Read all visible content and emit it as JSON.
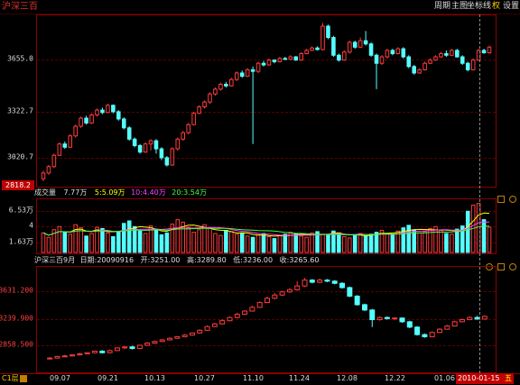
{
  "title": "沪深三百",
  "toolbar": {
    "zhouqi": "周期",
    "zhutu": "主图",
    "zuobiao": "坐标线",
    "quan": "权",
    "shezhi": "设置"
  },
  "main_axis": {
    "labels": [
      "3655.0",
      "3322.7",
      "3020.7"
    ],
    "current": "2818.2"
  },
  "volume": {
    "label": "成交量",
    "value": "7.77万",
    "ma5": "5:5.09万",
    "ma10": "10:4.40万",
    "ma20": "20:3.54万",
    "axis": [
      "6.53万",
      "4",
      "1.63万"
    ],
    "colors": {
      "ma5": "#ffff00",
      "ma10": "#ff40ff",
      "ma20": "#40ff40"
    }
  },
  "sub": {
    "name": "沪深三百9月",
    "date_label": "日期:",
    "date": "20090916",
    "open_label": "开:",
    "open": "3251.00",
    "high_label": "高:",
    "high": "3289.80",
    "low_label": "低:",
    "low": "3236.00",
    "close_label": "收:",
    "close": "3265.60",
    "axis": [
      "3631.200",
      "3239.900",
      "2858.500"
    ]
  },
  "xaxis": [
    "09.07",
    "09.21",
    "10.13",
    "10.27",
    "11.10",
    "11.24",
    "12.08",
    "12.22",
    "01.06"
  ],
  "bottom": {
    "code": "C1层",
    "date": "2010-01-15",
    "weekday": "五"
  },
  "colors": {
    "up": "#ff3b3b",
    "down": "#54ffff",
    "grid": "#5a0000",
    "frame": "#8b0000"
  },
  "chart_data": {
    "type": "candlestick",
    "main": {
      "ylim": [
        2818,
        3835
      ],
      "candles": [
        [
          2845,
          2880,
          2830,
          2895
        ],
        [
          2880,
          2920,
          2870,
          2930
        ],
        [
          2920,
          2990,
          2910,
          3000
        ],
        [
          2990,
          3060,
          2985,
          3070
        ],
        [
          3060,
          3040,
          3030,
          3075
        ],
        [
          3040,
          3110,
          3035,
          3120
        ],
        [
          3110,
          3170,
          3100,
          3180
        ],
        [
          3170,
          3220,
          3160,
          3230
        ],
        [
          3220,
          3190,
          3180,
          3235
        ],
        [
          3190,
          3240,
          3185,
          3250
        ],
        [
          3240,
          3270,
          3230,
          3280
        ],
        [
          3270,
          3255,
          3245,
          3285
        ],
        [
          3255,
          3300,
          3250,
          3310
        ],
        [
          3300,
          3260,
          3250,
          3305
        ],
        [
          3260,
          3215,
          3205,
          3270
        ],
        [
          3215,
          3160,
          3150,
          3225
        ],
        [
          3160,
          3090,
          3080,
          3170
        ],
        [
          3090,
          3050,
          3040,
          3100
        ],
        [
          3050,
          3010,
          3000,
          3060
        ],
        [
          3010,
          3060,
          3005,
          3070
        ],
        [
          3060,
          3080,
          3020,
          3090
        ],
        [
          3080,
          3030,
          3000,
          3090
        ],
        [
          3030,
          2975,
          2960,
          3040
        ],
        [
          2975,
          2930,
          2920,
          2985
        ],
        [
          2930,
          3030,
          2925,
          3040
        ],
        [
          3030,
          3090,
          3020,
          3100
        ],
        [
          3090,
          3130,
          3080,
          3140
        ],
        [
          3130,
          3180,
          3120,
          3190
        ],
        [
          3180,
          3250,
          3175,
          3260
        ],
        [
          3250,
          3290,
          3245,
          3300
        ],
        [
          3290,
          3320,
          3280,
          3330
        ],
        [
          3320,
          3370,
          3310,
          3380
        ],
        [
          3370,
          3400,
          3360,
          3410
        ],
        [
          3400,
          3430,
          3390,
          3440
        ],
        [
          3430,
          3420,
          3410,
          3445
        ],
        [
          3420,
          3460,
          3415,
          3470
        ],
        [
          3460,
          3500,
          3450,
          3510
        ],
        [
          3500,
          3480,
          3470,
          3515
        ],
        [
          3480,
          3520,
          3475,
          3530
        ],
        [
          3520,
          3510,
          3060,
          3540
        ],
        [
          3510,
          3560,
          3500,
          3570
        ],
        [
          3560,
          3550,
          3540,
          3575
        ],
        [
          3550,
          3580,
          3545,
          3590
        ],
        [
          3580,
          3570,
          3560,
          3585
        ],
        [
          3570,
          3590,
          3565,
          3600
        ],
        [
          3590,
          3585,
          3580,
          3600
        ],
        [
          3585,
          3600,
          3580,
          3610
        ],
        [
          3600,
          3580,
          3575,
          3605
        ],
        [
          3580,
          3620,
          3575,
          3630
        ],
        [
          3620,
          3640,
          3615,
          3650
        ],
        [
          3640,
          3655,
          3635,
          3665
        ],
        [
          3655,
          3645,
          3640,
          3665
        ],
        [
          3645,
          3790,
          3640,
          3810
        ],
        [
          3790,
          3720,
          3710,
          3800
        ],
        [
          3720,
          3610,
          3600,
          3730
        ],
        [
          3610,
          3580,
          3570,
          3620
        ],
        [
          3580,
          3630,
          3575,
          3640
        ],
        [
          3630,
          3690,
          3620,
          3700
        ],
        [
          3690,
          3660,
          3650,
          3700
        ],
        [
          3660,
          3700,
          3655,
          3720
        ],
        [
          3700,
          3680,
          3670,
          3760
        ],
        [
          3680,
          3610,
          3600,
          3690
        ],
        [
          3610,
          3560,
          3400,
          3620
        ],
        [
          3560,
          3600,
          3550,
          3610
        ],
        [
          3600,
          3640,
          3590,
          3650
        ],
        [
          3640,
          3620,
          3610,
          3650
        ],
        [
          3620,
          3650,
          3615,
          3660
        ],
        [
          3650,
          3600,
          3590,
          3660
        ],
        [
          3600,
          3540,
          3530,
          3610
        ],
        [
          3540,
          3500,
          3490,
          3550
        ],
        [
          3500,
          3520,
          3495,
          3530
        ],
        [
          3520,
          3560,
          3515,
          3570
        ],
        [
          3560,
          3580,
          3555,
          3590
        ],
        [
          3580,
          3600,
          3575,
          3610
        ],
        [
          3600,
          3620,
          3595,
          3630
        ],
        [
          3620,
          3610,
          3600,
          3640
        ],
        [
          3610,
          3640,
          3605,
          3650
        ],
        [
          3640,
          3600,
          3595,
          3650
        ],
        [
          3600,
          3560,
          3550,
          3610
        ],
        [
          3560,
          3520,
          3510,
          3570
        ],
        [
          3520,
          3580,
          3515,
          3590
        ],
        [
          3580,
          3640,
          3575,
          3650
        ],
        [
          3640,
          3625,
          3620,
          3650
        ],
        [
          3625,
          3660,
          3620,
          3670
        ]
      ]
    },
    "volume": {
      "values": [
        3.1,
        2.4,
        3.6,
        4.1,
        3.2,
        2.9,
        4.4,
        3.9,
        2.6,
        3.0,
        4.0,
        3.8,
        3.1,
        2.5,
        3.3,
        4.6,
        5.0,
        4.1,
        3.4,
        3.0,
        4.2,
        3.7,
        2.8,
        3.1,
        4.5,
        5.2,
        4.8,
        4.0,
        3.2,
        3.6,
        4.4,
        3.9,
        3.0,
        2.7,
        3.5,
        3.3,
        2.9,
        3.1,
        2.6,
        2.4,
        2.8,
        3.0,
        2.5,
        2.2,
        2.7,
        2.9,
        3.2,
        3.0,
        2.6,
        2.4,
        3.1,
        3.3,
        2.9,
        2.7,
        3.4,
        3.1,
        2.5,
        2.3,
        2.8,
        3.0,
        2.6,
        2.9,
        3.2,
        3.5,
        3.0,
        2.8,
        3.4,
        3.9,
        4.3,
        3.6,
        3.1,
        3.3,
        3.8,
        4.1,
        3.5,
        3.0,
        2.9,
        3.7,
        4.2,
        6.53,
        7.5,
        7.77,
        5.2,
        4.0
      ],
      "ylim": [
        0,
        8
      ]
    },
    "sub": {
      "ylim": [
        2780,
        3700
      ],
      "candles": [
        [
          2875,
          2880,
          2870,
          2890
        ],
        [
          2880,
          2895,
          2875,
          2900
        ],
        [
          2895,
          2900,
          2890,
          2910
        ],
        [
          2900,
          2910,
          2895,
          2915
        ],
        [
          2910,
          2920,
          2905,
          2930
        ],
        [
          2920,
          2930,
          2915,
          2935
        ],
        [
          2930,
          2945,
          2925,
          2950
        ],
        [
          2945,
          2930,
          2925,
          2955
        ],
        [
          2930,
          2950,
          2925,
          2960
        ],
        [
          2950,
          2975,
          2945,
          2980
        ],
        [
          2975,
          2985,
          2965,
          2990
        ],
        [
          2985,
          2970,
          2960,
          2995
        ],
        [
          2970,
          3000,
          2965,
          3005
        ],
        [
          3000,
          3020,
          2995,
          3030
        ],
        [
          3020,
          3035,
          3015,
          3045
        ],
        [
          3035,
          3050,
          3030,
          3060
        ],
        [
          3050,
          3065,
          3045,
          3075
        ],
        [
          3065,
          3080,
          3060,
          3085
        ],
        [
          3080,
          3095,
          3075,
          3105
        ],
        [
          3095,
          3115,
          3090,
          3120
        ],
        [
          3115,
          3140,
          3110,
          3150
        ],
        [
          3140,
          3175,
          3135,
          3185
        ],
        [
          3175,
          3200,
          3170,
          3210
        ],
        [
          3200,
          3230,
          3195,
          3245
        ],
        [
          3230,
          3260,
          3225,
          3270
        ],
        [
          3260,
          3290,
          3250,
          3305
        ],
        [
          3290,
          3320,
          3285,
          3330
        ],
        [
          3320,
          3355,
          3315,
          3370
        ],
        [
          3355,
          3400,
          3350,
          3410
        ],
        [
          3400,
          3440,
          3395,
          3455
        ],
        [
          3440,
          3470,
          3430,
          3490
        ],
        [
          3470,
          3500,
          3460,
          3510
        ],
        [
          3500,
          3520,
          3490,
          3535
        ],
        [
          3520,
          3555,
          3510,
          3600
        ],
        [
          3555,
          3610,
          3545,
          3630
        ],
        [
          3610,
          3590,
          3580,
          3620
        ],
        [
          3590,
          3610,
          3580,
          3625
        ],
        [
          3610,
          3600,
          3590,
          3620
        ],
        [
          3600,
          3580,
          3570,
          3610
        ],
        [
          3580,
          3540,
          3530,
          3590
        ],
        [
          3540,
          3460,
          3450,
          3550
        ],
        [
          3460,
          3380,
          3370,
          3470
        ],
        [
          3380,
          3330,
          3320,
          3390
        ],
        [
          3330,
          3240,
          3170,
          3340
        ],
        [
          3240,
          3260,
          3230,
          3270
        ],
        [
          3260,
          3250,
          3240,
          3270
        ],
        [
          3250,
          3255,
          3240,
          3260
        ],
        [
          3255,
          3220,
          3210,
          3260
        ],
        [
          3220,
          3170,
          3160,
          3230
        ],
        [
          3170,
          3100,
          3090,
          3180
        ],
        [
          3100,
          3080,
          3070,
          3110
        ],
        [
          3080,
          3120,
          3075,
          3130
        ],
        [
          3120,
          3150,
          3115,
          3160
        ],
        [
          3150,
          3180,
          3145,
          3190
        ],
        [
          3180,
          3220,
          3175,
          3230
        ],
        [
          3220,
          3240,
          3215,
          3250
        ],
        [
          3240,
          3260,
          3235,
          3270
        ],
        [
          3260,
          3245,
          3240,
          3275
        ],
        [
          3245,
          3270,
          3240,
          3280
        ]
      ]
    }
  }
}
